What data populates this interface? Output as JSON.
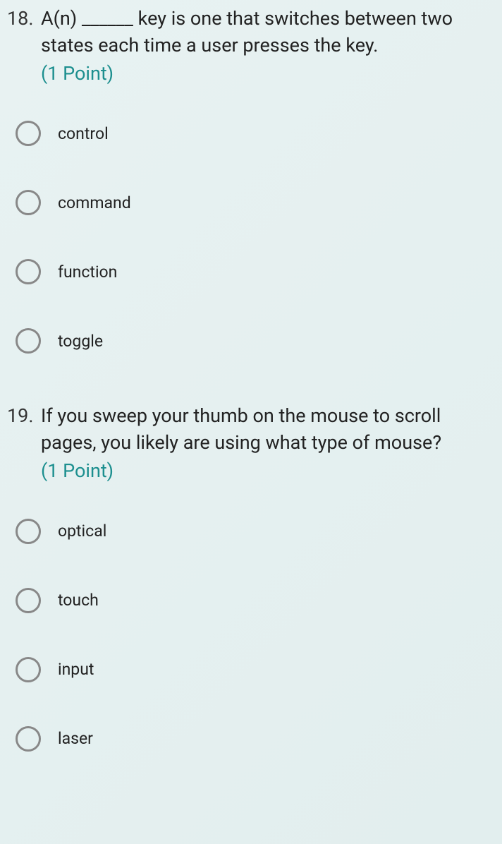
{
  "questions": [
    {
      "number": "18.",
      "text": "A(n) ______ key is one that switches between two states each time a user presses the key.",
      "points": "(1 Point)",
      "options": [
        {
          "label": "control"
        },
        {
          "label": "command"
        },
        {
          "label": "function"
        },
        {
          "label": "toggle"
        }
      ]
    },
    {
      "number": "19.",
      "text": "If you sweep your thumb on the mouse to scroll pages, you likely are using what type of mouse?",
      "points": "(1 Point)",
      "options": [
        {
          "label": "optical"
        },
        {
          "label": "touch"
        },
        {
          "label": "input"
        },
        {
          "label": "laser"
        }
      ]
    }
  ]
}
